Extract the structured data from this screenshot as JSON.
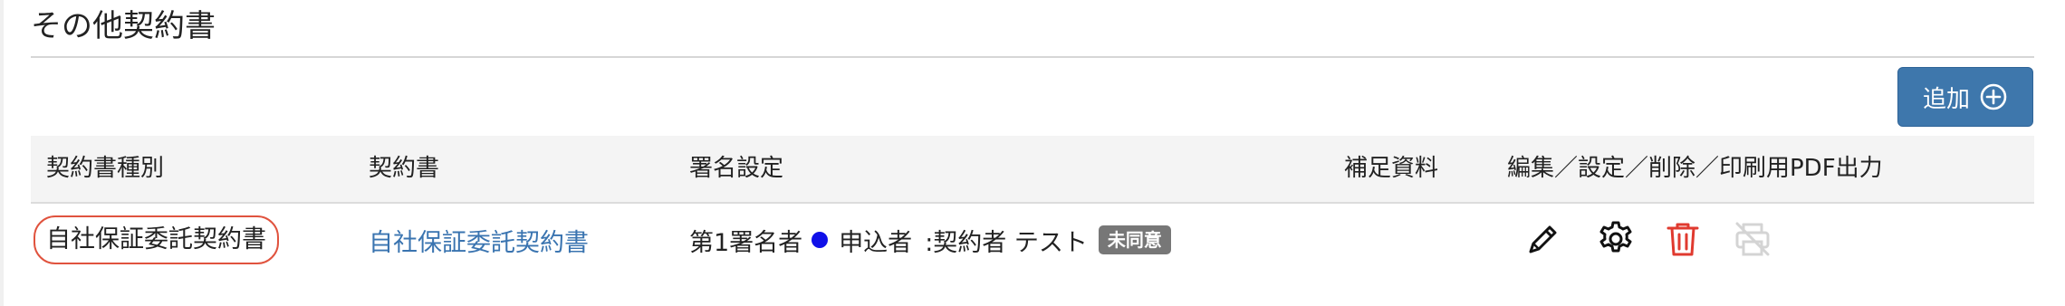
{
  "section": {
    "title": "その他契約書"
  },
  "toolbar": {
    "add_label": "追加",
    "add_icon": "plus-circle-icon"
  },
  "table": {
    "headers": [
      "契約書種別",
      "契約書",
      "署名設定",
      "補足資料",
      "編集／設定／削除／印刷用PDF出力"
    ],
    "rows": [
      {
        "type": "自社保証委託契約書",
        "document": "自社保証委託契約書",
        "signature": {
          "order": "第1署名者",
          "role": "申込者",
          "name": ":契約者 テスト",
          "status": "未同意",
          "dot_color": "#1010e8"
        },
        "supplement": "",
        "actions": {
          "edit_icon": "pencil-icon",
          "settings_icon": "gear-icon",
          "delete_icon": "trash-icon",
          "print_icon": "printer-icon",
          "delete_color": "#e03a2f",
          "print_disabled": true
        }
      }
    ]
  },
  "colors": {
    "accent": "#3e77ac",
    "link": "#3a74b0",
    "highlight_border": "#e0533e",
    "badge": "#777777"
  }
}
